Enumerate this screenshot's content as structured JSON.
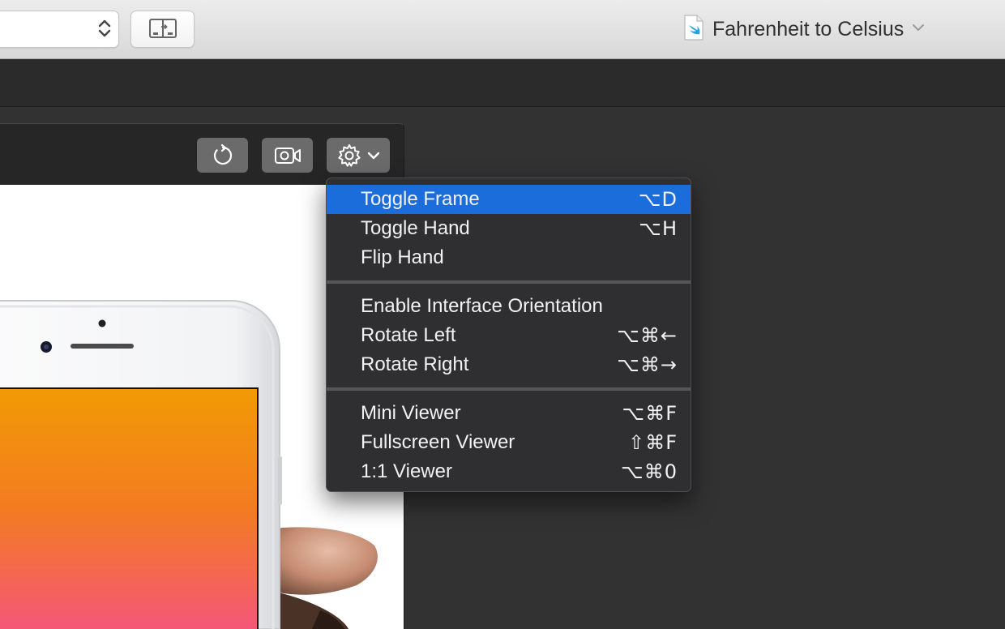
{
  "toolbar": {
    "document_title": "Fahrenheit to Celsius"
  },
  "menu": {
    "groups": [
      [
        {
          "label": "Toggle Frame",
          "shortcut": "⌥D"
        },
        {
          "label": "Toggle Hand",
          "shortcut": "⌥H"
        },
        {
          "label": "Flip Hand",
          "shortcut": ""
        }
      ],
      [
        {
          "label": "Enable Interface Orientation",
          "shortcut": ""
        },
        {
          "label": "Rotate Left",
          "shortcut": "⌥⌘←"
        },
        {
          "label": "Rotate Right",
          "shortcut": "⌥⌘→"
        }
      ],
      [
        {
          "label": "Mini Viewer",
          "shortcut": "⌥⌘F"
        },
        {
          "label": "Fullscreen Viewer",
          "shortcut": "⇧⌘F"
        },
        {
          "label": "1:1 Viewer",
          "shortcut": "⌥⌘0"
        }
      ]
    ],
    "highlighted_index": 0
  },
  "icons": {
    "scheme": "stepper-arrows-icon",
    "layout": "editor-layout-icon",
    "document": "swift-file-icon",
    "refresh": "refresh-icon",
    "record": "video-camera-icon",
    "settings": "gear-icon",
    "settings_menu": "chevron-down-icon"
  },
  "colors": {
    "menu_highlight": "#1b6ddb",
    "menu_background": "#2f2f31",
    "swift_icon": "#1fa3e6",
    "app_gradient_top": "#f29a05",
    "app_gradient_bottom": "#f4567a"
  }
}
